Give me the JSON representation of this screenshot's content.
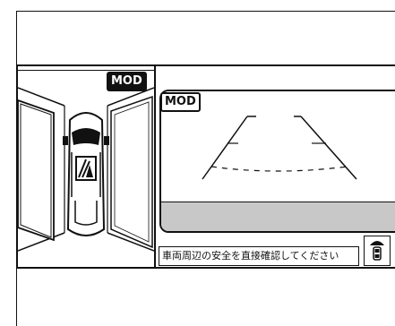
{
  "left_panel": {
    "mode_badge": "MOD"
  },
  "camera_panel": {
    "mode_badge": "MOD",
    "message": "車両周辺の安全を直接確認してください"
  },
  "colors": {
    "line": "#111111",
    "ground": "#c8c8c8",
    "background": "#ffffff"
  },
  "icons": {
    "car": "car-top-view-icon",
    "mirror": "side-mirror-icon",
    "sensor": "parking-sensor-icon"
  }
}
